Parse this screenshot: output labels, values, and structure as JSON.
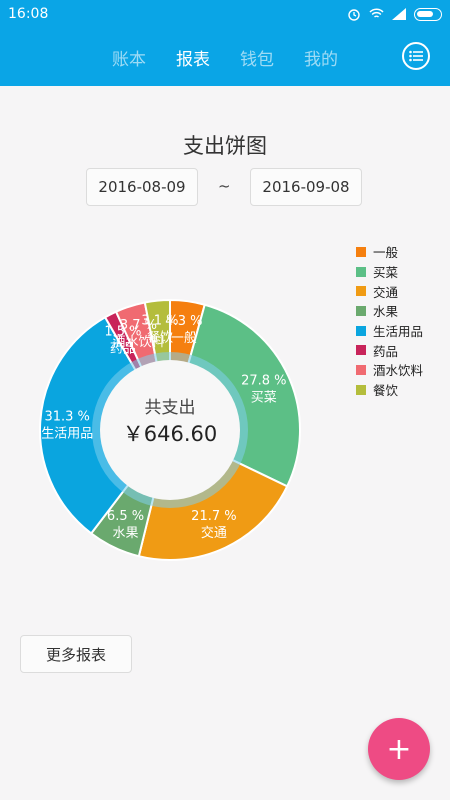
{
  "status": {
    "time": "16:08"
  },
  "nav": {
    "tabs": [
      "账本",
      "报表",
      "钱包",
      "我的"
    ],
    "active": 1
  },
  "page": {
    "title": "支出饼图",
    "date_from": "2016-08-09",
    "date_sep": "~",
    "date_to": "2016-09-08",
    "total_label": "共支出",
    "total_value": "￥646.60",
    "more_button": "更多报表"
  },
  "chart_data": {
    "type": "pie",
    "title": "支出饼图",
    "legend_position": "right",
    "slices": [
      {
        "name": "一般",
        "value": 4.3,
        "label": "4.3 %",
        "color": "#f57f0f"
      },
      {
        "name": "买菜",
        "value": 27.8,
        "label": "27.8 %",
        "color": "#5cbf86"
      },
      {
        "name": "交通",
        "value": 21.7,
        "label": "21.7 %",
        "color": "#f09b14"
      },
      {
        "name": "水果",
        "value": 6.5,
        "label": "6.5 %",
        "color": "#6aa96e"
      },
      {
        "name": "生活用品",
        "value": 31.3,
        "label": "31.3 %",
        "color": "#0aa5df"
      },
      {
        "name": "药品",
        "value": 1.5,
        "label": "1.5 %",
        "color": "#c8245a"
      },
      {
        "name": "酒水饮料",
        "value": 3.7,
        "label": "3.7 %",
        "color": "#f06a71"
      },
      {
        "name": "餐饮",
        "value": 3.1,
        "label": "3.1 %",
        "color": "#b4bd3c"
      }
    ]
  },
  "fab": {
    "label": "+"
  }
}
